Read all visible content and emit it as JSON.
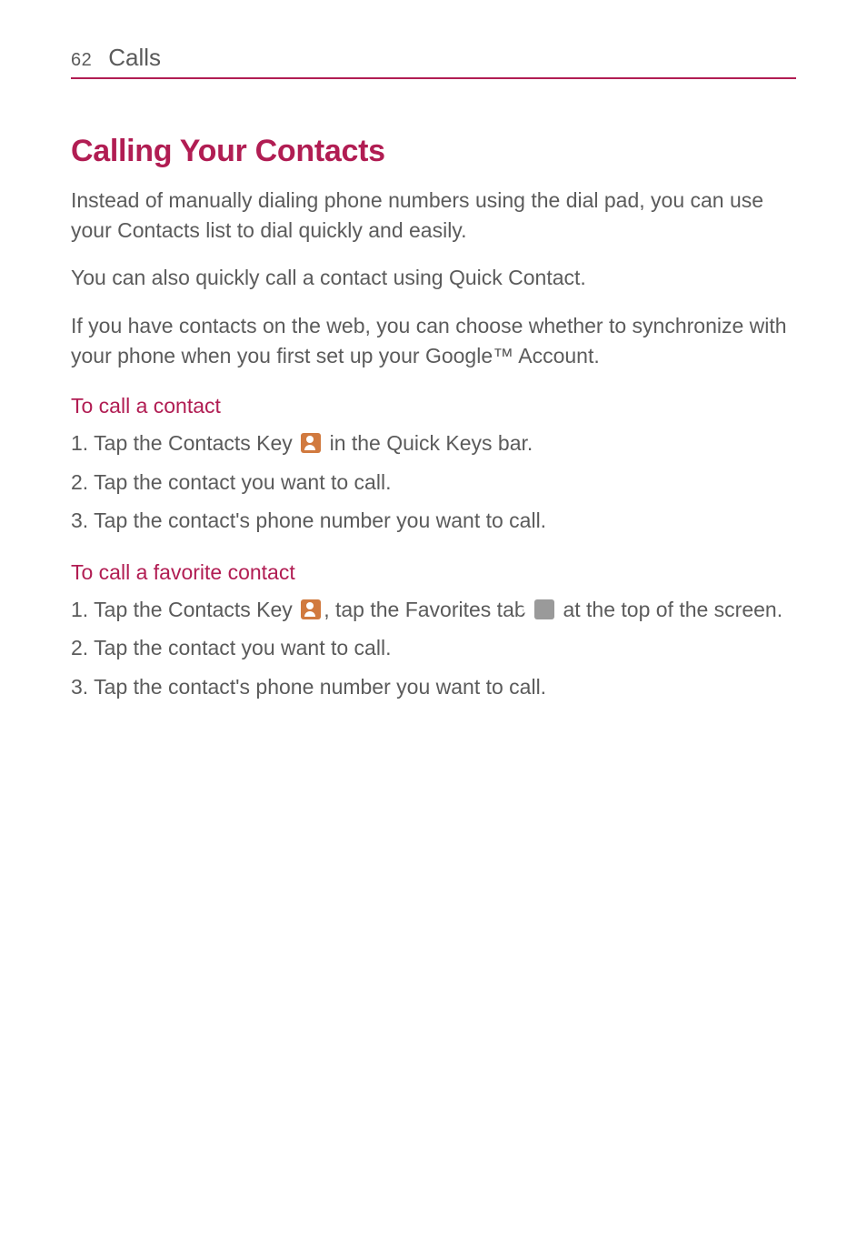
{
  "header": {
    "page_number": "62",
    "chapter": "Calls"
  },
  "section_title": "Calling Your Contacts",
  "intro": {
    "p1": "Instead of manually dialing phone numbers using the dial pad, you can use your Contacts list to dial quickly and easily.",
    "p2": "You can also quickly call a contact using Quick Contact.",
    "p3": "If you have contacts on the web, you can choose whether to synchronize with your phone when you first set up your Google™ Account."
  },
  "sub1": {
    "title": "To call a contact",
    "s1_prefix": "1.  Tap the ",
    "s1_bold": "Contacts Key",
    "s1_suffix": " in the Quick Keys bar.",
    "s2": "2.  Tap the contact you want to call.",
    "s3": "3. Tap the contact's phone number you want to call."
  },
  "sub2": {
    "title": "To call a favorite contact",
    "s1_prefix": "1.  Tap the ",
    "s1_bold1": "Contacts Key",
    "s1_mid": ", tap the ",
    "s1_bold2": "Favorites",
    "s1_mid2": " tab ",
    "s1_suffix": " at the top of the screen.",
    "s2": "2.  Tap the contact you want to call.",
    "s3": "3. Tap the contact's phone number you want to call."
  }
}
